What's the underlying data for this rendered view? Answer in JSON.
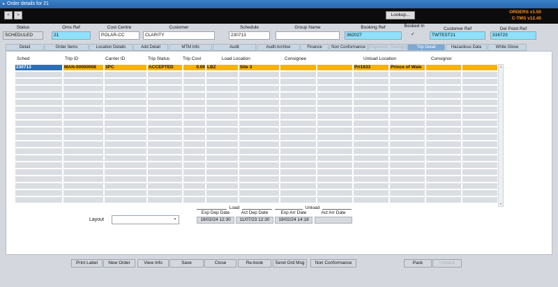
{
  "window": {
    "title": "Order details for 21"
  },
  "toolbar": {
    "prev": "<",
    "next": ">",
    "lookup": "Lookup..."
  },
  "versions": {
    "orders": "ORDERS v1.50",
    "ctms": "C-TMS v12.45"
  },
  "header": {
    "fields": [
      {
        "label": "Status",
        "value": "SCHEDULED"
      },
      {
        "label": "Oms Ref",
        "value": "21"
      },
      {
        "label": "Cost Centre",
        "value": "POLAR-CC"
      },
      {
        "label": "Customer",
        "value": "CLARITY"
      },
      {
        "label": "Schedule",
        "value": "230713"
      },
      {
        "label": "Group Name",
        "value": ""
      },
      {
        "label": "Booking Ref",
        "value": "362027"
      },
      {
        "label": "Booked In",
        "value": "✓"
      },
      {
        "label": "Customer Ref",
        "value": "TWTEST21"
      },
      {
        "label": "Del Point Ref",
        "value": "316723"
      }
    ]
  },
  "tabs": [
    "Detail",
    "Order Items",
    "Location Details",
    "Add Detail",
    "MTM Info",
    "Audit",
    "Audit Archive",
    "Finance",
    "Non Conformance",
    "Payments_Savings",
    "Trip Detail",
    "Hazardous Data",
    "White Glove"
  ],
  "grid": {
    "columns": [
      "Sched",
      "Trip ID",
      "Carrier ID",
      "Trip Status",
      "Trip Cost",
      "Load Location",
      "",
      "Consignee",
      "",
      "Unload Location",
      "",
      "Consignor",
      ""
    ],
    "rows": [
      [
        "230713",
        "MAN-00000008",
        "3PC",
        "ACCEPTED",
        "0.00",
        "LBZ",
        "Site 3",
        "",
        "",
        "Pri1633",
        "Prince of Wale",
        "",
        ""
      ]
    ]
  },
  "layout": {
    "label": "Layout",
    "value": ""
  },
  "dates": {
    "load_label": "Load",
    "unload_label": "Unload",
    "exp_dep_label": "Exp Dep Date",
    "act_dep_label": "Act Dep Date",
    "exp_arr_label": "Exp Arr Date",
    "act_arr_label": "Act Arr Date",
    "exp_dep": "19/02/24 12:30",
    "act_dep": "11/07/23 12:30",
    "exp_arr": "19/02/24 14:18",
    "act_arr": ""
  },
  "buttons": {
    "print_label": "Print Label",
    "new_order": "New Order",
    "view_info": "View Info",
    "save": "Save",
    "close": "Close",
    "rebook": "Re-book",
    "send_ord_msg": "Send Ord Msg",
    "non_conformance": "Non Conformance",
    "pack": "Pack",
    "unpack": "Unpack"
  }
}
